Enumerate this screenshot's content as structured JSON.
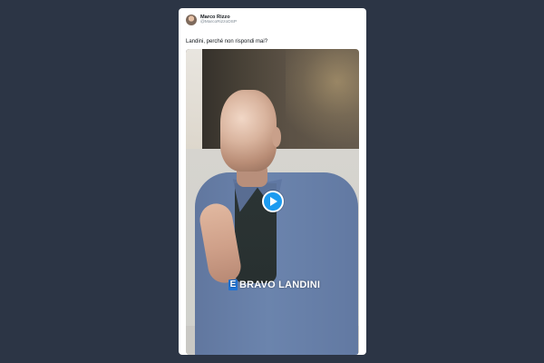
{
  "tweet": {
    "display_name": "Marco Rizzo",
    "handle": "@MarcoRizzoDSP",
    "text": "Landini, perché non rispondi mai?"
  },
  "media": {
    "watermark_logo": "E",
    "watermark_text": "BRAVO LANDINI",
    "play_icon": "play-icon"
  },
  "colors": {
    "background": "#2c3545",
    "card": "#ffffff",
    "accent": "#1d9bf0"
  }
}
